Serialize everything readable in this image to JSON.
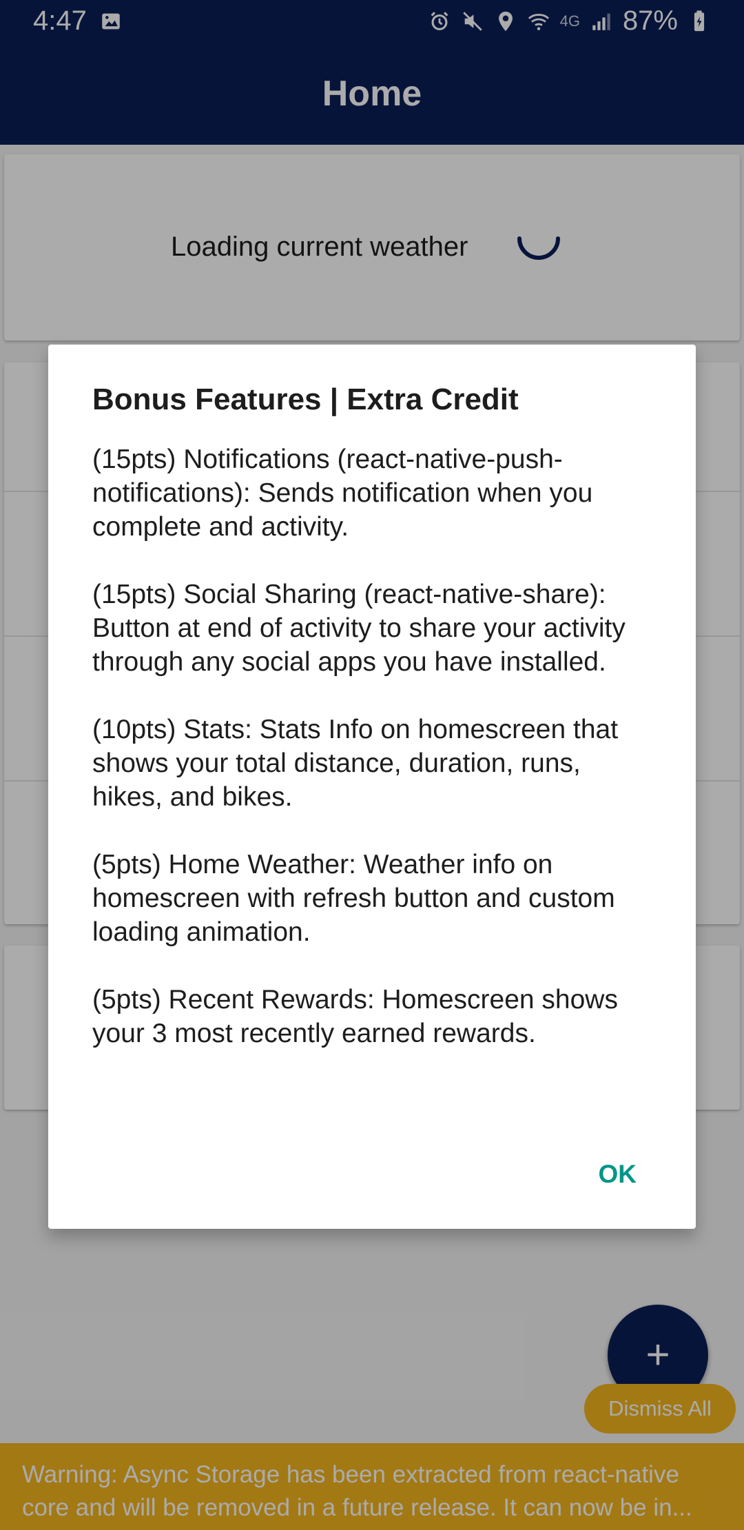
{
  "status_bar": {
    "time": "4:47",
    "battery": "87%",
    "network": "4G",
    "icons": [
      "image-icon",
      "alarm-icon",
      "mute-icon",
      "location-icon",
      "wifi-icon",
      "signal-icon",
      "battery-icon"
    ]
  },
  "header": {
    "title": "Home"
  },
  "weather": {
    "loading_text": "Loading current weather"
  },
  "dialog": {
    "title": "Bonus Features | Extra Credit",
    "items": [
      "(15pts) Notifications (react-native-push-notifications): Sends notification when you complete and activity.",
      "(15pts) Social Sharing (react-native-share): Button at end of activity to share your activity through any social apps you have installed.",
      "(10pts) Stats: Stats Info on homescreen that shows your total distance, duration, runs, hikes, and bikes.",
      "(5pts) Home Weather: Weather info on homescreen with refresh button and custom loading animation.",
      "(5pts) Recent Rewards: Homescreen shows your 3 most recently earned rewards."
    ],
    "ok_label": "OK"
  },
  "fab": {
    "icon": "plus-icon",
    "label": "+"
  },
  "toast": {
    "dismiss_label": "Dismiss All",
    "warning_text": "Warning: Async Storage has been extracted from react-native core and will be removed in a future release. It can now be in..."
  },
  "colors": {
    "header_bg": "#0b1f57",
    "accent_teal": "#009688",
    "warning_yellow": "#f3b51f"
  }
}
